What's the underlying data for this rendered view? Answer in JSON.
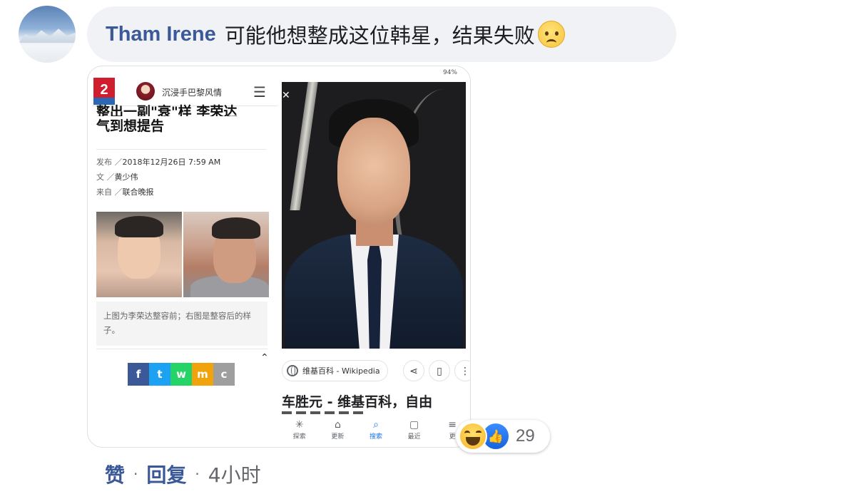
{
  "comment": {
    "author": "Tham Irene",
    "text": "可能他想整成这位韩星，结果失败",
    "emoji": "sad-face-emoji"
  },
  "image": {
    "left_panel": {
      "site_name": "沉浸手巴黎风情",
      "headline_line1": "整出一副\"衰\"样 李荣达",
      "headline_line2": "气到想提告",
      "meta_published_label": "发布",
      "meta_published_value": "2018年12月26日 7:59 AM",
      "meta_author_label": "文",
      "meta_author_value": "黄少伟",
      "meta_source_label": "来自",
      "meta_source_value": "联合晚报",
      "photo_caption": "上图为李荣达整容前；右图是整容后的样子。",
      "share_icons": [
        "f",
        "t",
        "w",
        "m",
        "c"
      ],
      "share_colors": [
        "#3b5998",
        "#1da1f2",
        "#25d366",
        "#f0a30a",
        "#9e9e9e"
      ]
    },
    "right_panel": {
      "status_bar": "94%",
      "source_label": "维基百科 - Wikipedia",
      "result_title": "车胜元 - 维基百科，自由",
      "nav": [
        {
          "icon": "✳",
          "label": "探索"
        },
        {
          "icon": "⌂",
          "label": "更新"
        },
        {
          "icon": "⌕",
          "label": "搜索"
        },
        {
          "icon": "▢",
          "label": "最近"
        },
        {
          "icon": "≡",
          "label": "更"
        }
      ]
    }
  },
  "reactions": {
    "count": "29",
    "types": [
      "haha-icon",
      "like-icon"
    ]
  },
  "actions": {
    "like": "赞",
    "reply": "回复",
    "time": "4小时"
  }
}
